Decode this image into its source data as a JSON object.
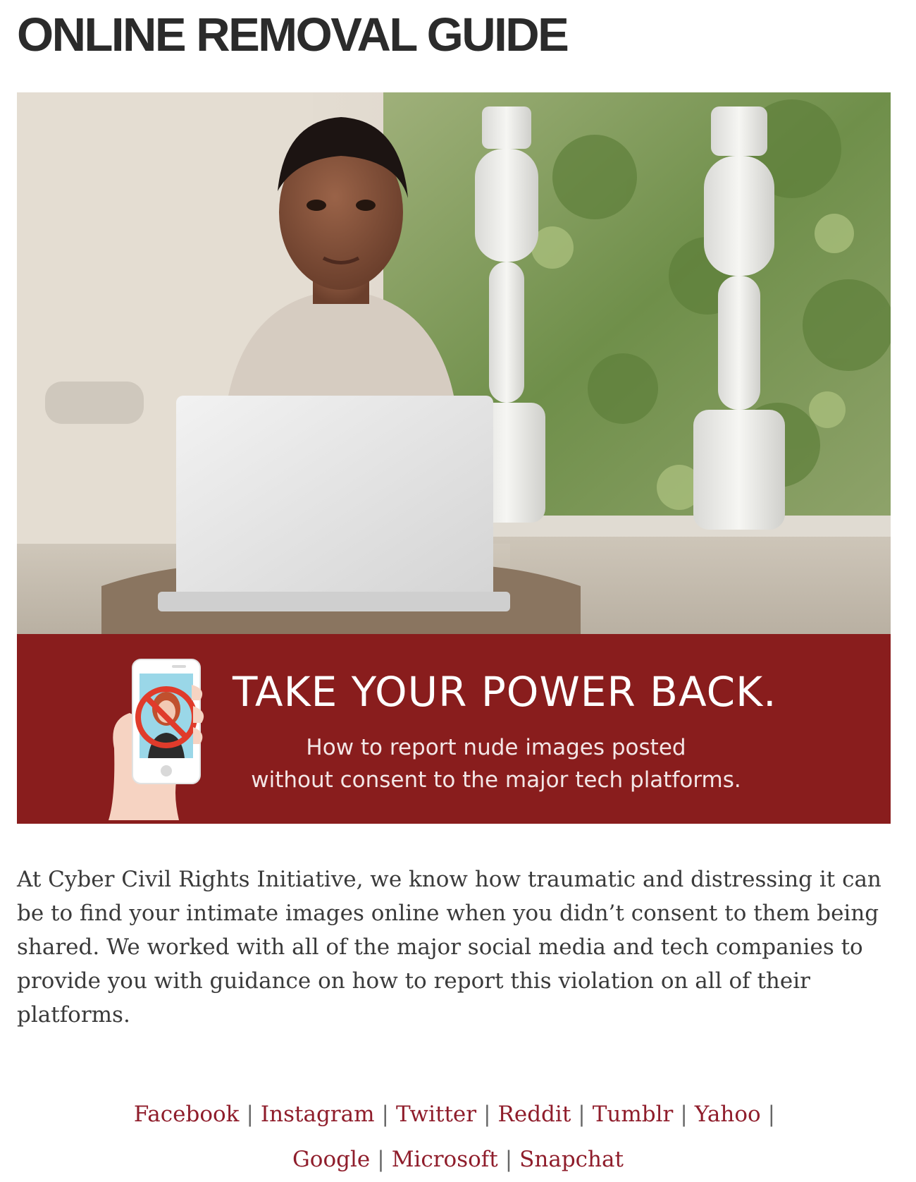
{
  "page": {
    "title": "ONLINE REMOVAL GUIDE"
  },
  "banner": {
    "headline": "TAKE YOUR POWER BACK.",
    "subline_1": "How to report nude images posted",
    "subline_2": "without consent to the major tech platforms.",
    "color": "#891d1d"
  },
  "intro": {
    "lines": [
      "At Cyber Civil Rights Initiative, we know how traumatic and distressing it can",
      "be to find your intimate images online when you didn’t consent to them being",
      "shared. We worked with all of the major social media and tech companies to",
      "provide you with guidance on how to report this violation on all of their",
      "platforms."
    ]
  },
  "platforms": {
    "separator": "|",
    "link_color": "#8f1d2b",
    "links": [
      "Facebook",
      "Instagram",
      "Twitter",
      "Reddit",
      "Tumblr",
      "Yahoo",
      "Google",
      "Microsoft",
      "Snapchat"
    ]
  }
}
